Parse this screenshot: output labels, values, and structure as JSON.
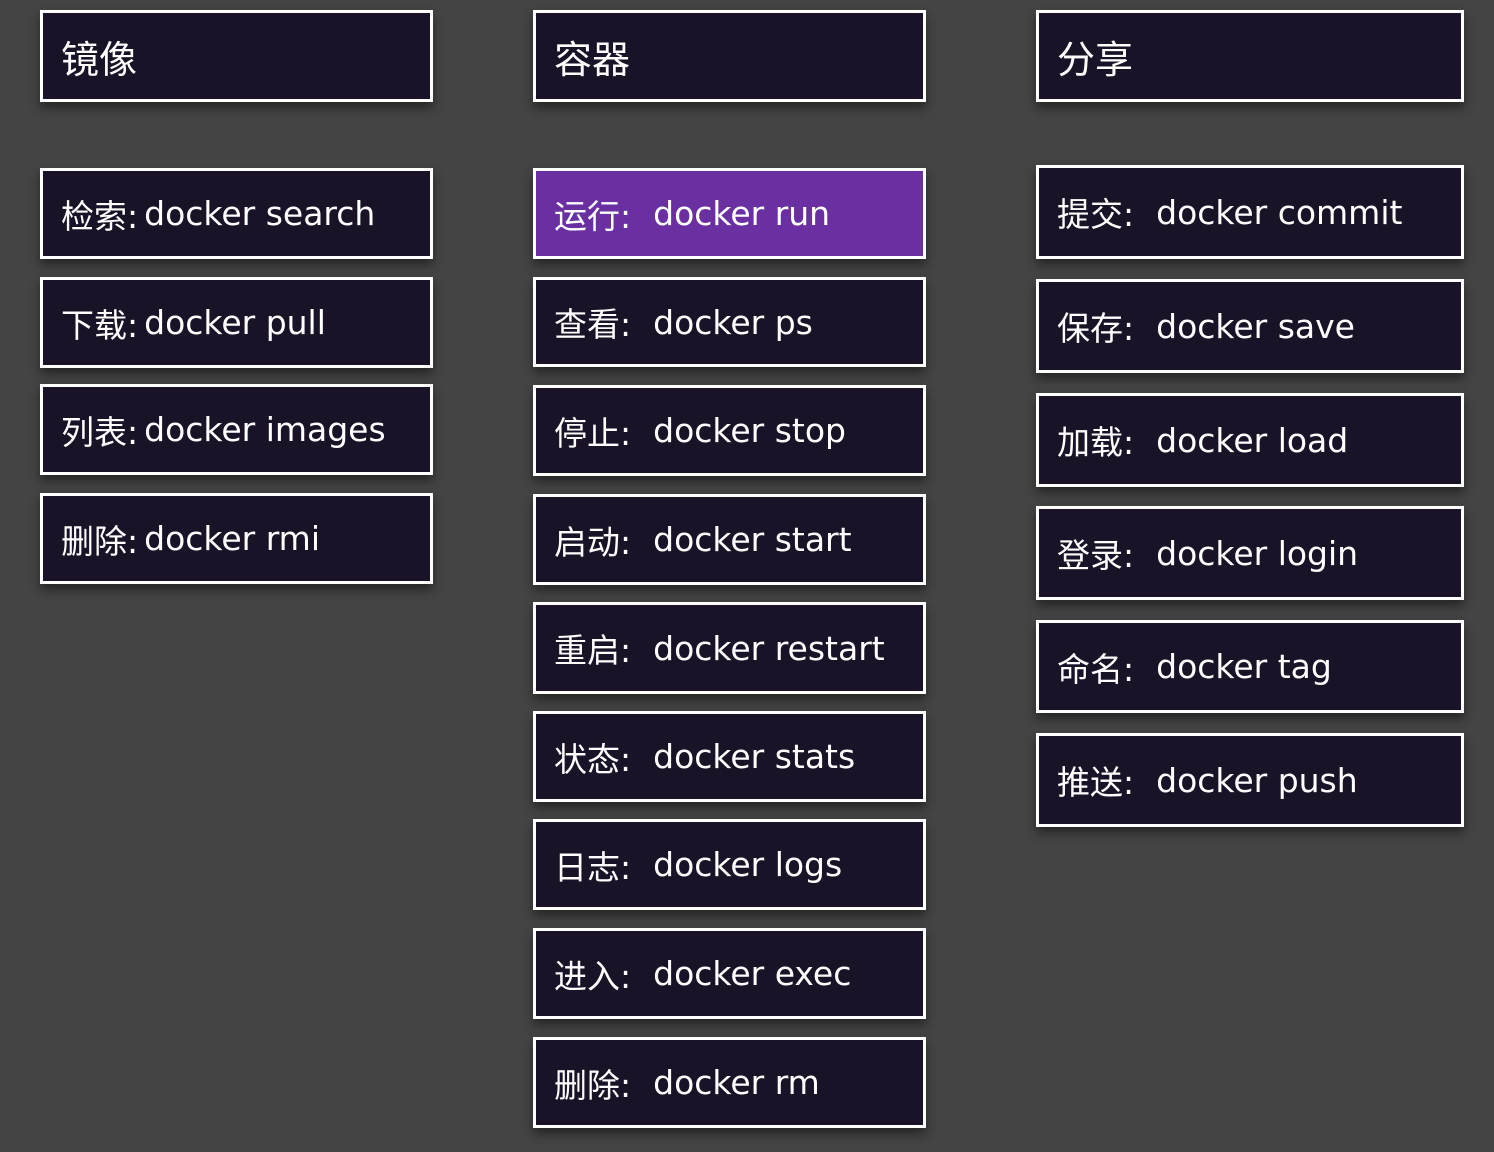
{
  "columns": [
    {
      "id": "images",
      "header": "镜像",
      "items": [
        {
          "label": "检索:",
          "command": "docker search"
        },
        {
          "label": "下载:",
          "command": "docker pull"
        },
        {
          "label": "列表:",
          "command": "docker images"
        },
        {
          "label": "删除:",
          "command": "docker rmi"
        }
      ]
    },
    {
      "id": "containers",
      "header": "容器",
      "items": [
        {
          "label": "运行:",
          "command": "docker run"
        },
        {
          "label": "查看:",
          "command": "docker ps"
        },
        {
          "label": "停止:",
          "command": "docker stop"
        },
        {
          "label": "启动:",
          "command": "docker start"
        },
        {
          "label": "重启:",
          "command": "docker restart"
        },
        {
          "label": "状态:",
          "command": "docker stats"
        },
        {
          "label": "日志:",
          "command": "docker logs"
        },
        {
          "label": "进入:",
          "command": "docker exec"
        },
        {
          "label": "删除:",
          "command": "docker rm"
        }
      ]
    },
    {
      "id": "share",
      "header": "分享",
      "items": [
        {
          "label": "提交:",
          "command": "docker commit"
        },
        {
          "label": "保存:",
          "command": "docker save"
        },
        {
          "label": "加载:",
          "command": "docker load"
        },
        {
          "label": "登录:",
          "command": "docker login"
        },
        {
          "label": "命名:",
          "command": "docker tag"
        },
        {
          "label": "推送:",
          "command": "docker push"
        }
      ]
    }
  ],
  "colors": {
    "background": "#444444",
    "box_fill": "#1a1226",
    "box_border": "#ffffff",
    "highlight_fill": "#6a2fa0",
    "text": "#ffffff"
  }
}
